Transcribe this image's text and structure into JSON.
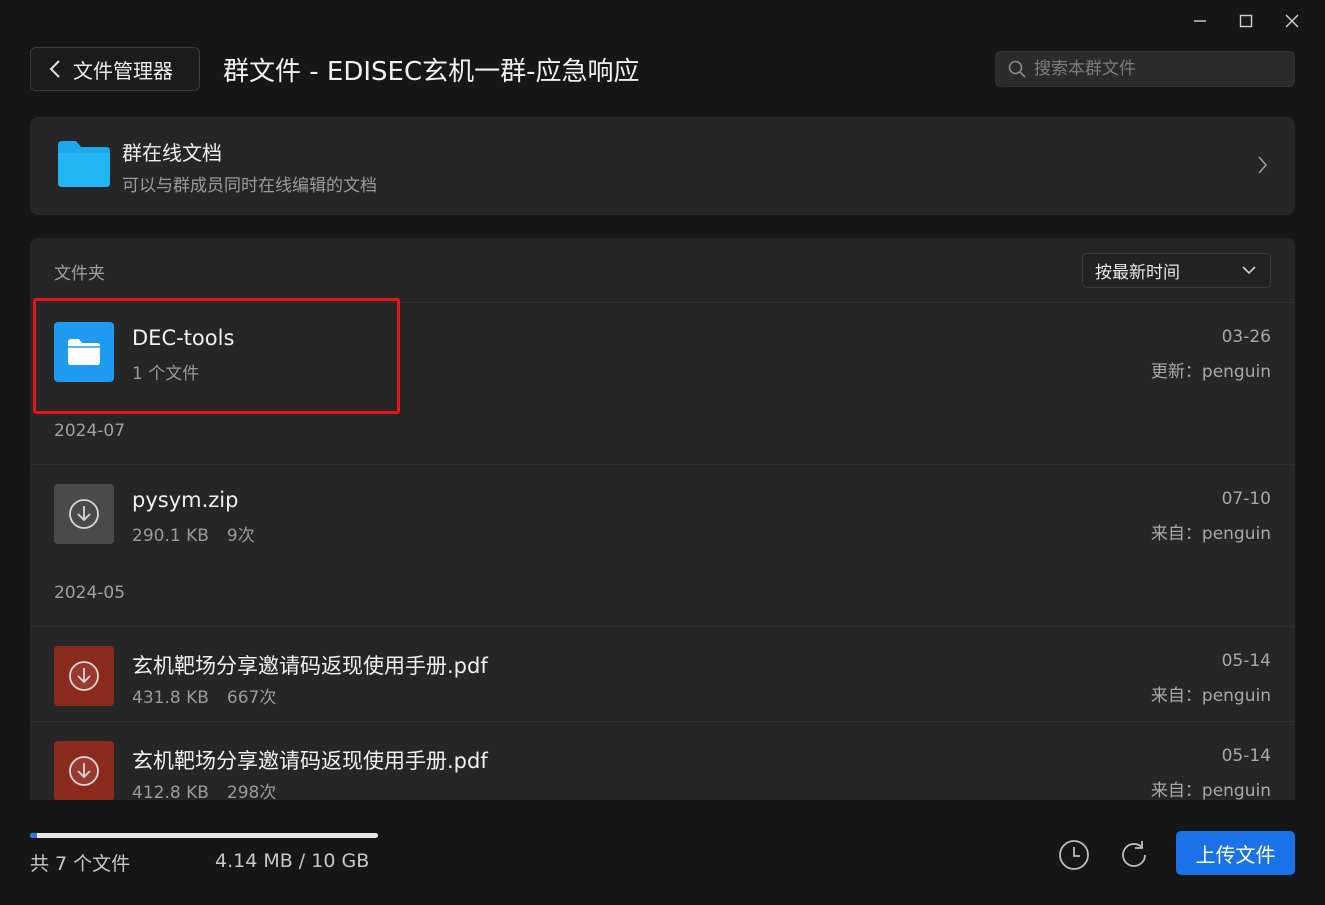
{
  "header": {
    "back_label": "文件管理器",
    "title": "群文件 - EDISEC玄机一群-应急响应",
    "search_placeholder": "搜索本群文件"
  },
  "online_docs": {
    "title": "群在线文档",
    "subtitle": "可以与群成员同时在线编辑的文档"
  },
  "panel": {
    "section_label": "文件夹",
    "sort_label": "按最新时间"
  },
  "folder": {
    "name": "DEC-tools",
    "meta": "1 个文件",
    "date": "03-26",
    "updated_by": "更新：penguin"
  },
  "groups": [
    "2024-07",
    "2024-05"
  ],
  "files": [
    {
      "name": "pysym.zip",
      "size": "290.1 KB",
      "downloads": "9次",
      "date": "07-10",
      "from": "来自：penguin"
    },
    {
      "name": "玄机靶场分享邀请码返现使用手册.pdf",
      "size": "431.8 KB",
      "downloads": "667次",
      "date": "05-14",
      "from": "来自：penguin"
    },
    {
      "name": "玄机靶场分享邀请码返现使用手册.pdf",
      "size": "412.8 KB",
      "downloads": "298次",
      "date": "05-14",
      "from": "来自：penguin"
    }
  ],
  "footer": {
    "count": "共 7 个文件",
    "storage": "4.14 MB / 10 GB",
    "usage_fraction": 0.02,
    "upload_label": "上传文件"
  },
  "colors": {
    "accent": "#1a72e8",
    "highlight": "#e8141b",
    "folder": "#1e9bf0",
    "pdf": "#8b2b1e"
  }
}
